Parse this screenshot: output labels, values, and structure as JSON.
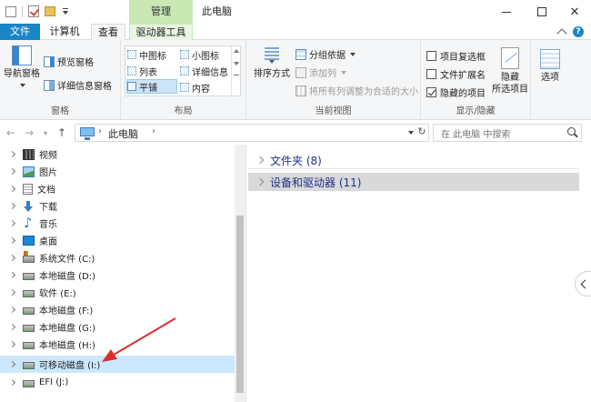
{
  "window": {
    "title": "此电脑",
    "context_tab_title": "管理"
  },
  "ribbon_tabs": {
    "file": "文件",
    "computer": "计算机",
    "view": "查看",
    "drive_tools": "驱动器工具"
  },
  "ribbon": {
    "panes": {
      "nav_pane": "导航窗格",
      "preview_pane": "预览窗格",
      "details_pane": "详细信息窗格",
      "label": "窗格"
    },
    "layout": {
      "items": [
        "中图标",
        "小图标",
        "列表",
        "详细信息",
        "平铺",
        "内容"
      ],
      "selected": "平铺",
      "label": "布局"
    },
    "current_view": {
      "sort_by": "排序方式",
      "group_by": "分组依据",
      "add_columns": "添加列",
      "size_all_columns": "将所有列调整为合适的大小",
      "label": "当前视图"
    },
    "show_hide": {
      "item_checkboxes": "项目复选框",
      "file_extensions": "文件扩展名",
      "hidden_items": "隐藏的项目",
      "hide_selected": "隐藏",
      "hide_selected_line2": "所选项目",
      "hidden_items_checked": true,
      "label": "显示/隐藏"
    },
    "options": {
      "label": "选项"
    }
  },
  "address": {
    "path": "此电脑",
    "search_placeholder": "在 此电脑 中搜索"
  },
  "nav_tree": [
    {
      "label": "视频",
      "icon": "video-icon"
    },
    {
      "label": "图片",
      "icon": "pictures-icon"
    },
    {
      "label": "文档",
      "icon": "documents-icon"
    },
    {
      "label": "下载",
      "icon": "downloads-icon"
    },
    {
      "label": "音乐",
      "icon": "music-icon"
    },
    {
      "label": "桌面",
      "icon": "desktop-icon"
    },
    {
      "label": "系统文件 (C:)",
      "icon": "system-drive-icon"
    },
    {
      "label": "本地磁盘 (D:)",
      "icon": "drive-icon"
    },
    {
      "label": "软件 (E:)",
      "icon": "drive-icon"
    },
    {
      "label": "本地磁盘 (F:)",
      "icon": "drive-icon"
    },
    {
      "label": "本地磁盘 (G:)",
      "icon": "drive-icon"
    },
    {
      "label": "本地磁盘 (H:)",
      "icon": "drive-icon"
    },
    {
      "label": "可移动磁盘 (I:)",
      "icon": "drive-icon",
      "selected": true
    },
    {
      "label": "EFI (J:)",
      "icon": "drive-icon"
    }
  ],
  "content": {
    "folders_header": "文件夹 (8)",
    "devices_header": "设备和驱动器 (11)"
  },
  "colors": {
    "file_tab": "#1a86c7",
    "context_tab": "#c9e8b4",
    "section_header_text": "#1e3287",
    "selection": "#cce8ff",
    "annotation_arrow": "#d9302c"
  }
}
